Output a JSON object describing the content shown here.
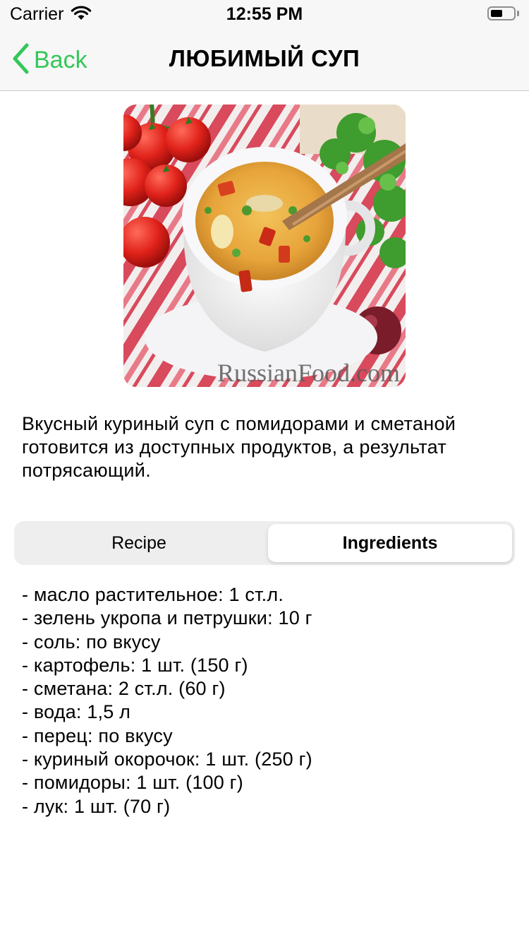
{
  "status_bar": {
    "carrier": "Carrier",
    "time": "12:55 PM"
  },
  "nav": {
    "back_label": "Back",
    "title": "ЛЮБИМЫЙ СУП",
    "accent_color": "#34c759"
  },
  "image": {
    "watermark": "RussianFood.com"
  },
  "description": "Вкусный куриный суп с помидорами и сметаной готовится из доступных продуктов, а результат потрясающий.",
  "tabs": {
    "recipe": "Recipe",
    "ingredients": "Ingredients",
    "selected": "Ingredients"
  },
  "ingredients": [
    "- масло растительное: 1 ст.л.",
    "- зелень укропа и петрушки: 10 г",
    "- соль: по вкусу",
    "- картофель: 1 шт. (150 г)",
    "- сметана: 2 ст.л. (60 г)",
    "- вода: 1,5 л",
    "- перец: по вкусу",
    "- куриный окорочок: 1 шт. (250 г)",
    "- помидоры: 1 шт. (100 г)",
    "- лук: 1 шт. (70 г)"
  ]
}
